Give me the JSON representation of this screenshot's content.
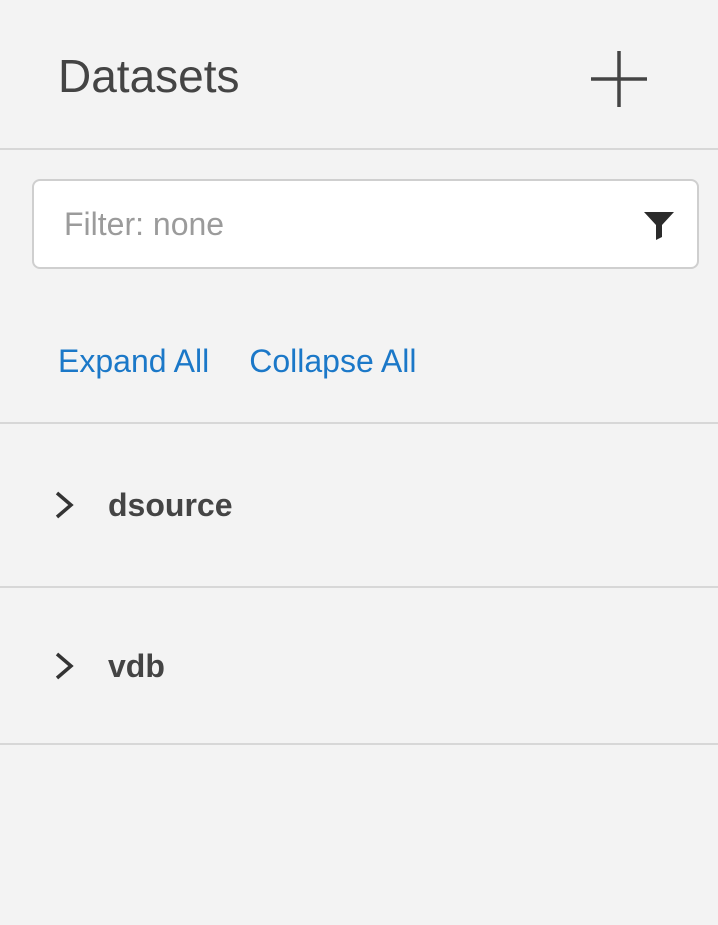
{
  "header": {
    "title": "Datasets",
    "add_icon": "plus-icon"
  },
  "filter": {
    "placeholder": "Filter: none",
    "value": "",
    "icon": "funnel-icon"
  },
  "actions": {
    "expand_all": "Expand All",
    "collapse_all": "Collapse All"
  },
  "tree": {
    "items": [
      {
        "label": "dsource",
        "expanded": false,
        "icon": "chevron-right-icon"
      },
      {
        "label": "vdb",
        "expanded": false,
        "icon": "chevron-right-icon"
      }
    ]
  },
  "colors": {
    "background": "#f3f3f3",
    "link": "#1b78c8",
    "text": "#444444",
    "divider": "#d7d7d7"
  }
}
